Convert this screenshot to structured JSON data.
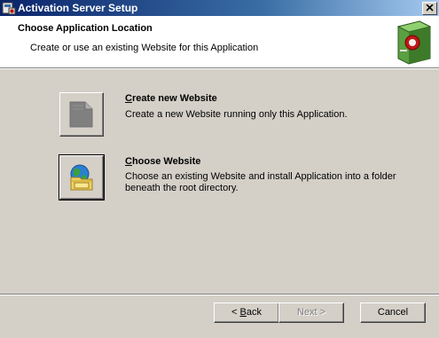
{
  "window": {
    "title": "Activation Server Setup"
  },
  "header": {
    "title": "Choose Application Location",
    "subtitle": "Create or use an existing Website for this Application"
  },
  "options": [
    {
      "title": "Create new Website",
      "mnemonic": "C",
      "rest": "reate new Website",
      "description": "Create a new Website running only this Application.",
      "icon": "blank-page-icon",
      "enabled": false
    },
    {
      "title": "Choose Website",
      "mnemonic": "C",
      "rest": "hoose Website",
      "description": "Choose an existing Website and install Application into a folder beneath the root directory.",
      "icon": "globe-folder-icon",
      "enabled": true
    }
  ],
  "buttons": {
    "back_mnemonic": "B",
    "back_prefix": "< ",
    "back_rest": "ack",
    "next": "Next >",
    "cancel": "Cancel"
  },
  "colors": {
    "titlebar_start": "#0a246a",
    "titlebar_end": "#a6caf0",
    "face": "#d4d0c8"
  }
}
